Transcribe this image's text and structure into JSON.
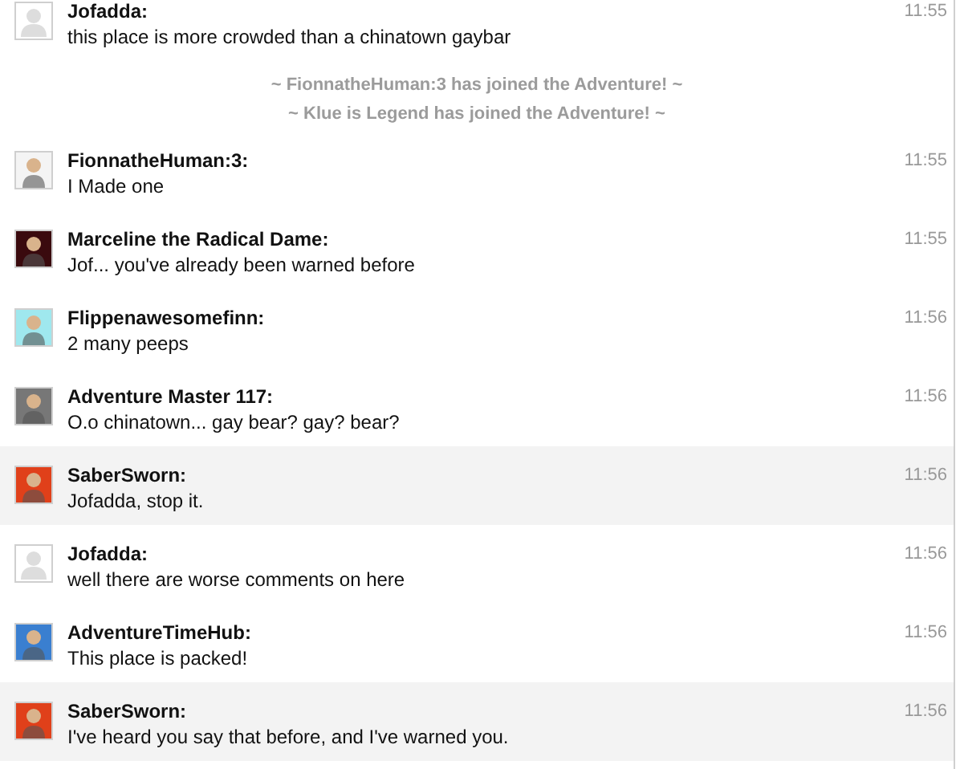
{
  "chat": [
    {
      "kind": "message",
      "user": "Jofadda:",
      "text": "this place is more crowded than a chinatown gaybar",
      "time": "11:55",
      "highlighted": false,
      "avatar": {
        "kind": "default",
        "color": "#dddddd"
      }
    },
    {
      "kind": "notice",
      "text": "~ FionnatheHuman:3 has joined the Adventure! ~"
    },
    {
      "kind": "notice",
      "text": "~ Klue is Legend has joined the Adventure! ~"
    },
    {
      "kind": "message",
      "user": "FionnatheHuman:3:",
      "text": "I Made one",
      "time": "11:55",
      "highlighted": false
    },
    {
      "kind": "message",
      "user": "Marceline the Radical Dame:",
      "text": "Jof... you've already been warned before",
      "time": "11:55",
      "highlighted": false
    },
    {
      "kind": "message",
      "user": "Flippenawesomefinn:",
      "text": "2 many peeps",
      "time": "11:56",
      "highlighted": false
    },
    {
      "kind": "message",
      "user": "Adventure Master 117:",
      "text": "O.o chinatown... gay bear? gay? bear?",
      "time": "11:56",
      "highlighted": false
    },
    {
      "kind": "message",
      "user": "SaberSworn:",
      "text": "Jofadda, stop it.",
      "time": "11:56",
      "highlighted": true
    },
    {
      "kind": "message",
      "user": "Jofadda:",
      "text": "well there are worse comments on here",
      "time": "11:56",
      "highlighted": false,
      "avatar": {
        "kind": "default",
        "color": "#dddddd"
      }
    },
    {
      "kind": "message",
      "user": "AdventureTimeHub:",
      "text": "This place is packed!",
      "time": "11:56",
      "highlighted": false
    },
    {
      "kind": "message",
      "user": "SaberSworn:",
      "text": "I've heard you say that before, and I've warned you.",
      "time": "11:56",
      "highlighted": true
    }
  ]
}
